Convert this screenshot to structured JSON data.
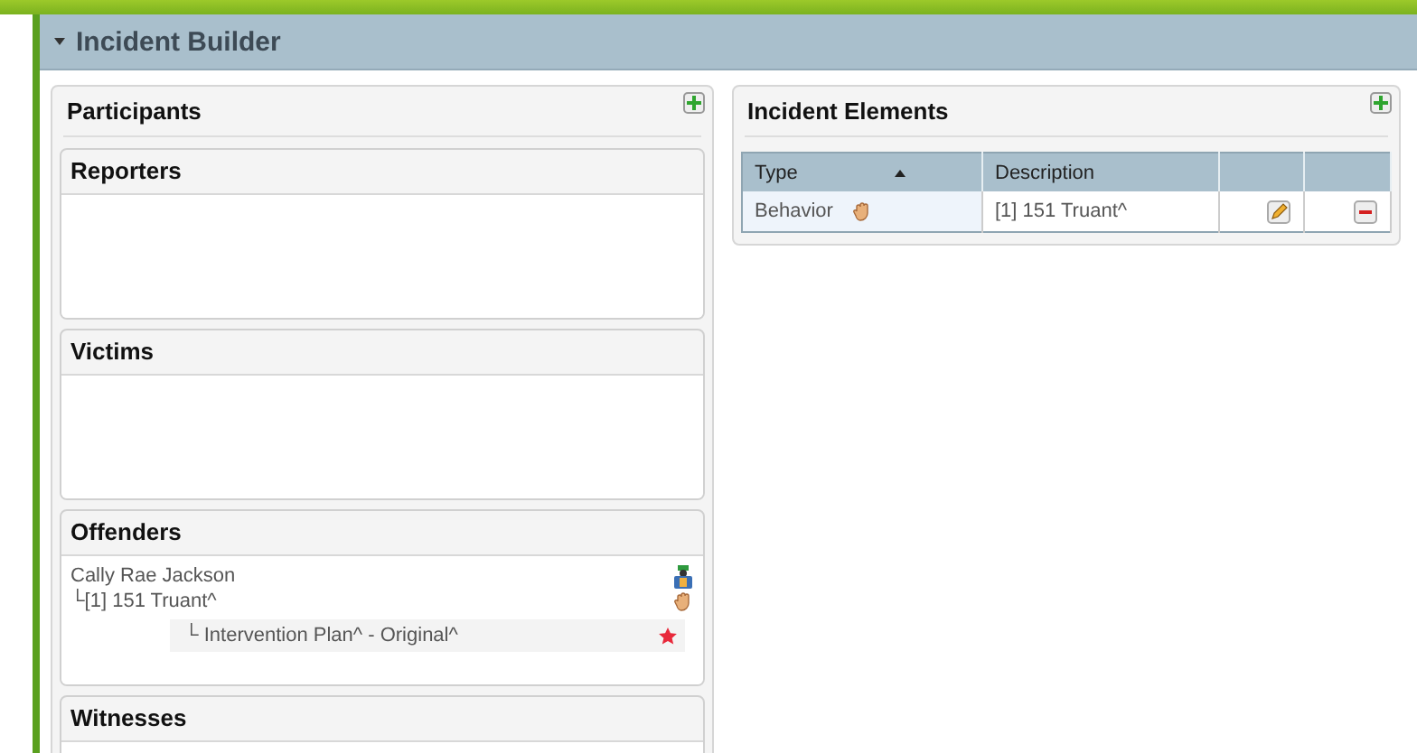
{
  "section": {
    "title": "Incident Builder",
    "expanded": true
  },
  "participants": {
    "title": "Participants",
    "groups": [
      {
        "title": "Reporters"
      },
      {
        "title": "Victims"
      },
      {
        "title": "Offenders",
        "entries": [
          {
            "name": "Cally Rae Jackson",
            "children": [
              {
                "label": "└[1] 151 Truant^",
                "children": [
                  {
                    "label": "└ Intervention Plan^ - Original^"
                  }
                ]
              }
            ]
          }
        ]
      },
      {
        "title": "Witnesses"
      }
    ]
  },
  "elements": {
    "title": "Incident Elements",
    "columns": [
      {
        "label": "Type",
        "sorted": true
      },
      {
        "label": "Description",
        "sorted": false
      }
    ],
    "rows": [
      {
        "type": "Behavior",
        "description": "[1] 151 Truant^"
      }
    ]
  }
}
